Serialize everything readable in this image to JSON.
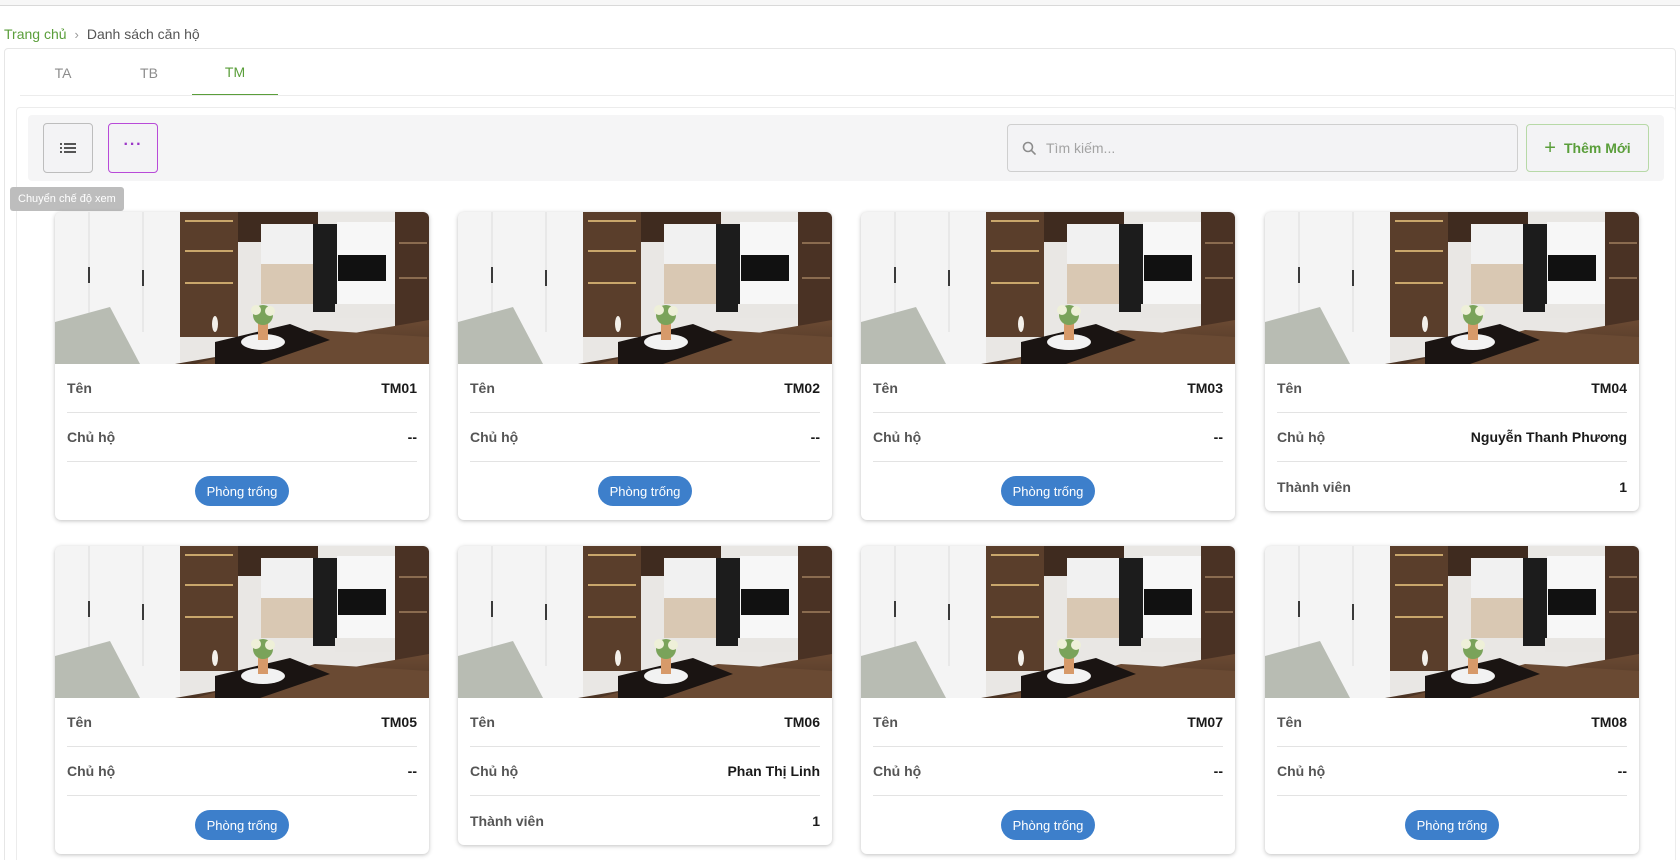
{
  "breadcrumb": {
    "home": "Trang chủ",
    "separator": "›",
    "current": "Danh sách căn hộ"
  },
  "tabs": [
    {
      "label": "TA",
      "active": false
    },
    {
      "label": "TB",
      "active": false
    },
    {
      "label": "TM",
      "active": true
    }
  ],
  "toolbar": {
    "view_toggle_icon": "list-icon",
    "more_icon": "more-dots-icon",
    "more_label": "···",
    "tooltip": "Chuyển chế độ xem",
    "search_placeholder": "Tìm kiếm...",
    "search_icon": "search-icon",
    "add_label": "Thêm Mới",
    "add_icon": "plus-icon",
    "plus_glyph": "+"
  },
  "labels": {
    "name": "Tên",
    "owner": "Chủ hộ",
    "members": "Thành viên"
  },
  "colors": {
    "accent_green": "#5a9e3a",
    "status_blue": "#3d7fcb",
    "more_purple": "#b84ad8"
  },
  "cards": [
    {
      "name": "TM01",
      "owner": "--",
      "members": null,
      "status": "Phòng trống"
    },
    {
      "name": "TM02",
      "owner": "--",
      "members": null,
      "status": "Phòng trống"
    },
    {
      "name": "TM03",
      "owner": "--",
      "members": null,
      "status": "Phòng trống"
    },
    {
      "name": "TM04",
      "owner": "Nguyễn Thanh Phương",
      "members": "1",
      "status": null
    },
    {
      "name": "TM05",
      "owner": "--",
      "members": null,
      "status": "Phòng trống"
    },
    {
      "name": "TM06",
      "owner": "Phan Thị Linh",
      "members": "1",
      "status": null
    },
    {
      "name": "TM07",
      "owner": "--",
      "members": null,
      "status": "Phòng trống"
    },
    {
      "name": "TM08",
      "owner": "--",
      "members": null,
      "status": "Phòng trống"
    }
  ]
}
